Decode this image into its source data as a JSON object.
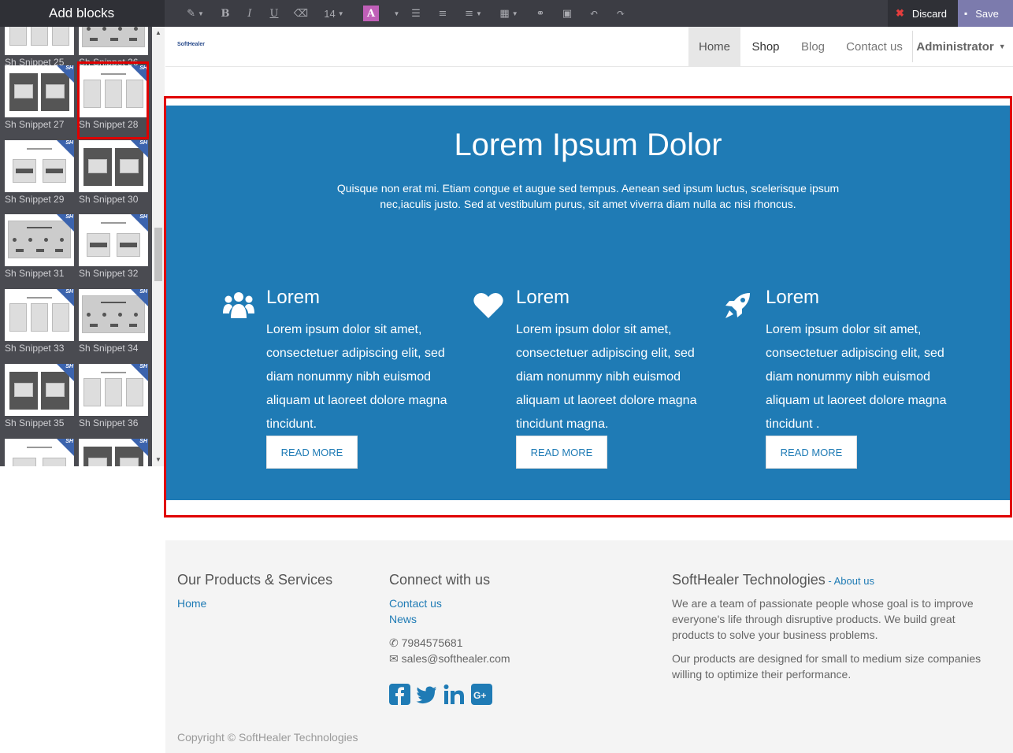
{
  "topbar": {
    "add_blocks": "Add blocks",
    "font_size": "14",
    "discard": "Discard",
    "save": "Save"
  },
  "sidebar": {
    "snippets": [
      {
        "label": "Sh Snippet 25"
      },
      {
        "label": "Sh Snippet 26"
      },
      {
        "label": "Sh Snippet 27"
      },
      {
        "label": "Sh Snippet 28"
      },
      {
        "label": "Sh Snippet 29"
      },
      {
        "label": "Sh Snippet 30"
      },
      {
        "label": "Sh Snippet 31"
      },
      {
        "label": "Sh Snippet 32"
      },
      {
        "label": "Sh Snippet 33"
      },
      {
        "label": "Sh Snippet 34"
      },
      {
        "label": "Sh Snippet 35"
      },
      {
        "label": "Sh Snippet 36"
      }
    ],
    "badge": "SH"
  },
  "navbar": {
    "logo": "SoftHealer",
    "items": [
      "Home",
      "Shop",
      "Blog",
      "Contact us"
    ],
    "user": "Administrator"
  },
  "hero": {
    "title": "Lorem Ipsum Dolor",
    "intro": "Quisque non erat mi. Etiam congue et augue sed tempus. Aenean sed ipsum luctus, scelerisque ipsum nec,iaculis justo. Sed at vestibulum purus, sit amet viverra diam nulla ac nisi rhoncus.",
    "columns": [
      {
        "icon": "users-icon",
        "heading": "Lorem",
        "text": "Lorem ipsum dolor sit amet, consectetuer adipiscing elit, sed diam nonummy nibh euismod aliquam ut laoreet dolore magna tincidunt.",
        "button": "READ MORE"
      },
      {
        "icon": "heart-icon",
        "heading": "Lorem",
        "text": "Lorem ipsum dolor sit amet, consectetuer adipiscing elit, sed diam nonummy nibh euismod aliquam ut laoreet dolore magna tincidunt magna.",
        "button": "READ MORE"
      },
      {
        "icon": "rocket-icon",
        "heading": "Lorem",
        "text": "Lorem ipsum dolor sit amet, consectetuer adipiscing elit, sed diam nonummy nibh euismod aliquam ut laoreet dolore magna tincidunt .",
        "button": "READ MORE"
      }
    ]
  },
  "footer": {
    "products_title": "Our Products & Services",
    "products_links": [
      "Home"
    ],
    "connect_title": "Connect with us",
    "connect_links": [
      "Contact us",
      "News"
    ],
    "phone": "7984575681",
    "email": "sales@softhealer.com",
    "company_title": "SoftHealer Technologies",
    "company_sep": " - ",
    "about_link": "About us",
    "company_p1": "We are a team of passionate people whose goal is to improve everyone's life through disruptive products. We build great products to solve your business problems.",
    "company_p2": "Our products are designed for small to medium size companies willing to optimize their performance.",
    "copyright": "Copyright © SoftHealer Technologies"
  },
  "colors": {
    "hero_bg": "#1f7bb5",
    "selection": "#e00000",
    "save_bg": "#7c7bad",
    "badge": "#3b63ad"
  }
}
